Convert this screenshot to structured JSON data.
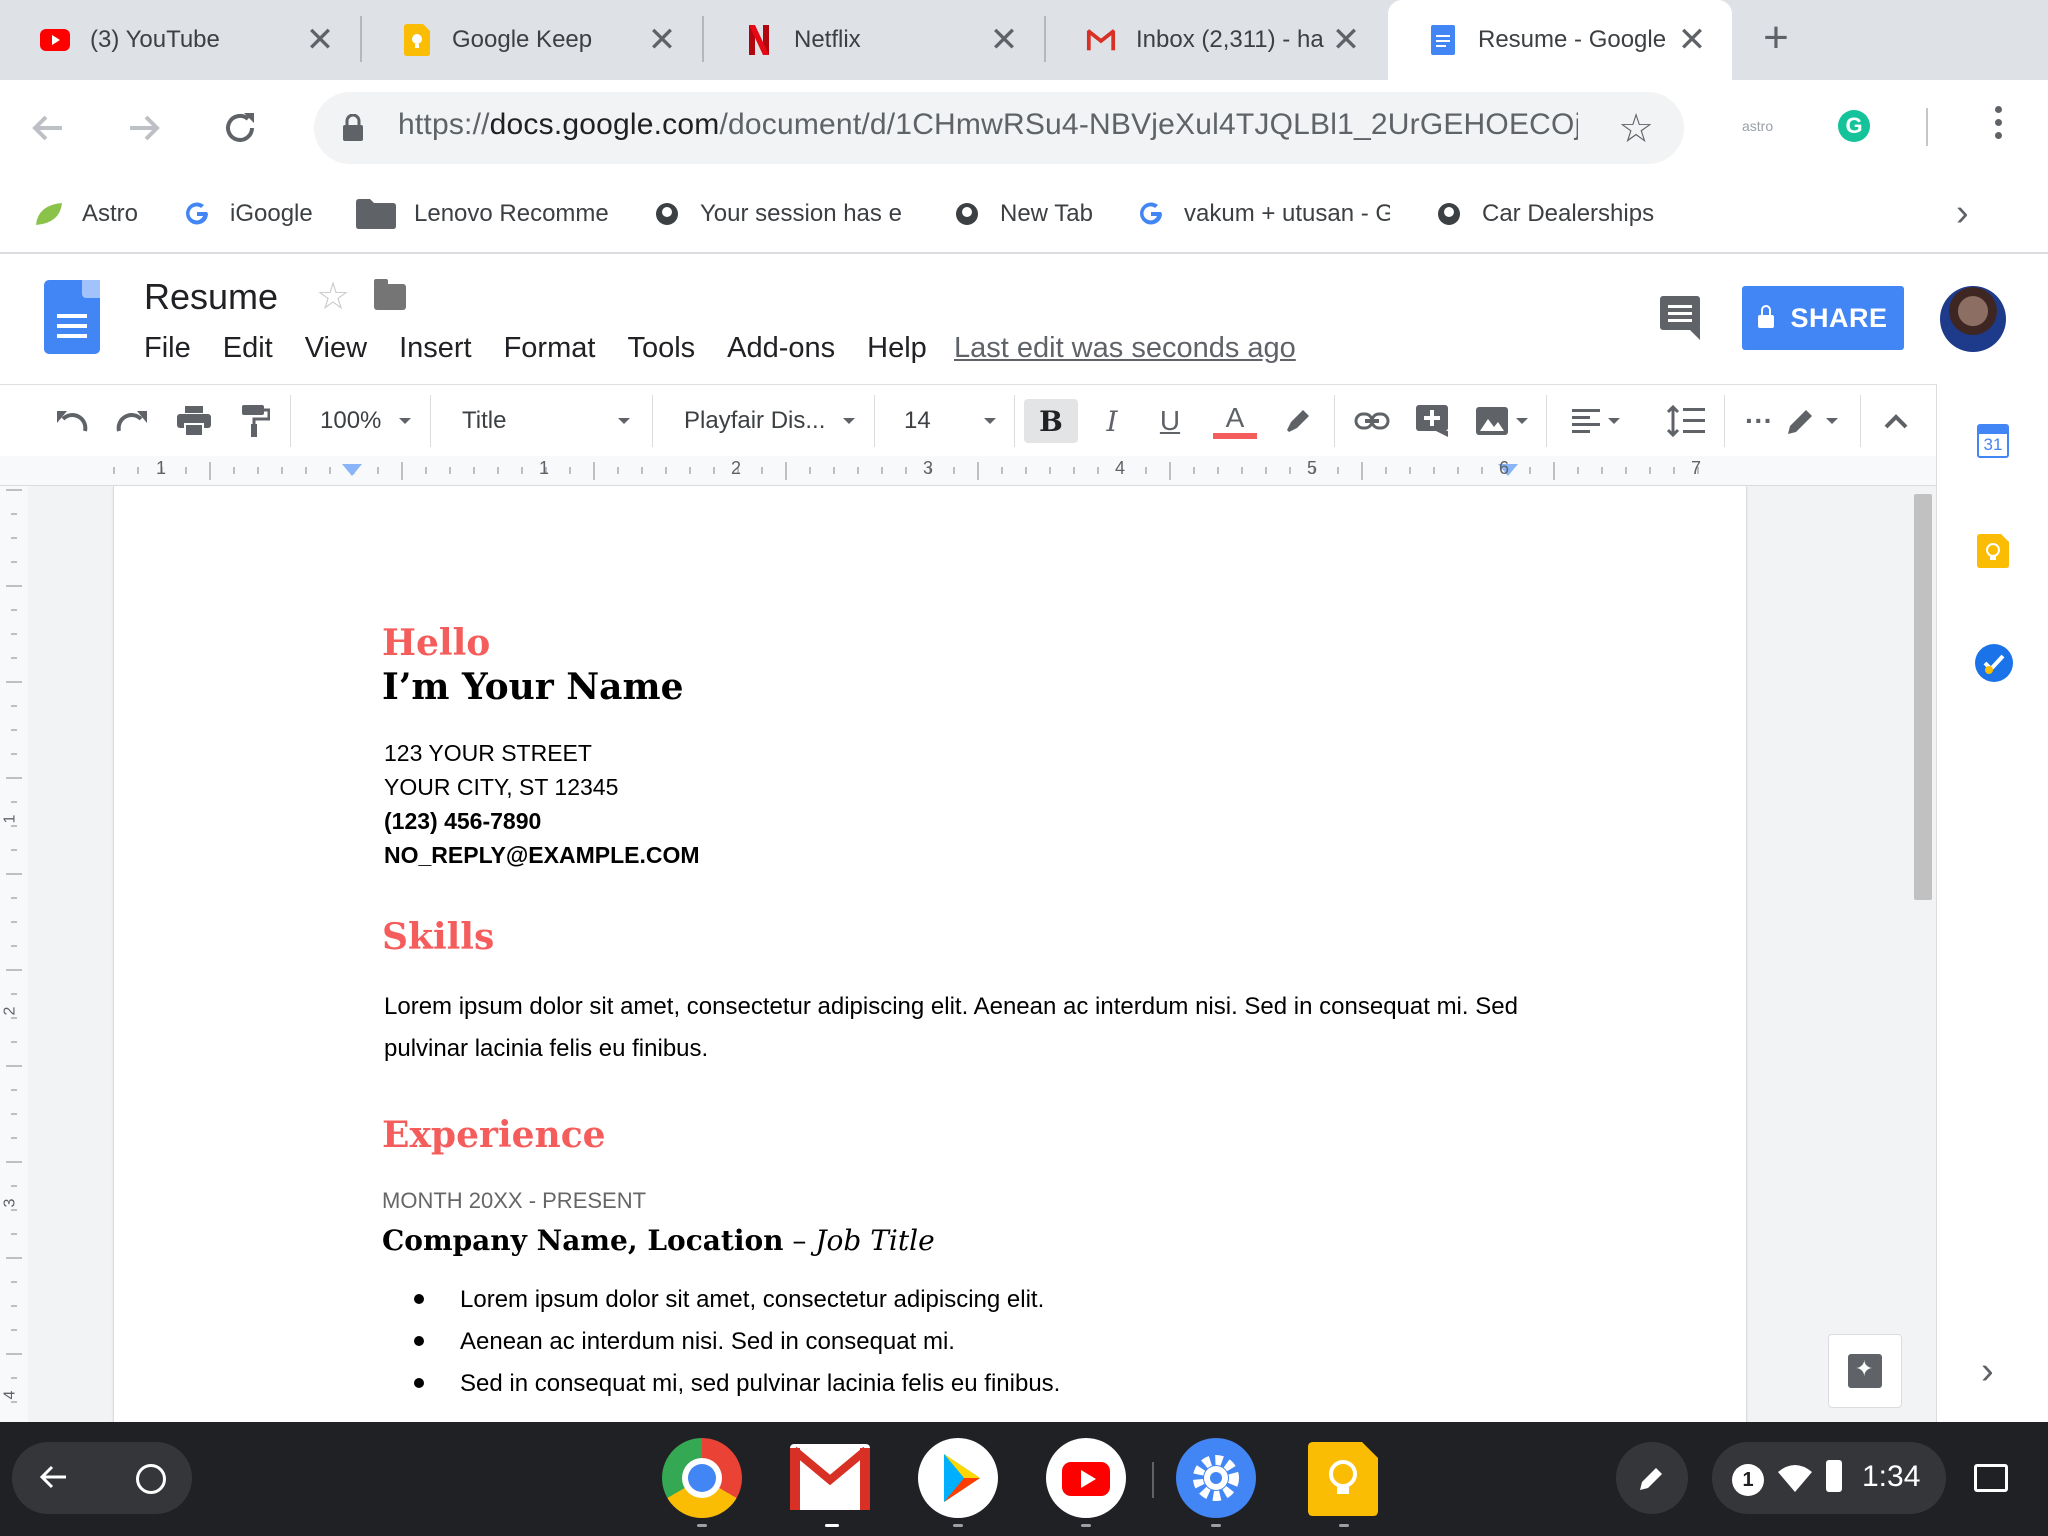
{
  "browser": {
    "tabs": [
      {
        "title": "(3) YouTube",
        "icon": "youtube-icon"
      },
      {
        "title": "Google Keep",
        "icon": "keep-icon"
      },
      {
        "title": "Netflix",
        "icon": "netflix-icon"
      },
      {
        "title": "Inbox (2,311) - ha",
        "icon": "gmail-icon"
      },
      {
        "title": "Resume - Google D",
        "icon": "docs-icon",
        "active": true
      }
    ],
    "url_prefix": "https://",
    "url_host": "docs.google.com",
    "url_path": "/document/d/1CHmwRSu4-NBVjeXul4TJQLBl1_2UrGEHOECOj...",
    "extension_label": "astro",
    "grammarly_letter": "G",
    "bookmarks": [
      {
        "label": "Astro",
        "icon": "astro-leaf-icon"
      },
      {
        "label": "iGoogle",
        "icon": "google-g-icon"
      },
      {
        "label": "Lenovo Recomme",
        "icon": "folder-icon"
      },
      {
        "label": "Your session has e",
        "icon": "site-icon"
      },
      {
        "label": "New Tab",
        "icon": "site-icon"
      },
      {
        "label": "vakum + utusan - G",
        "icon": "google-g-icon"
      },
      {
        "label": "Car Dealerships",
        "icon": "site-icon"
      }
    ]
  },
  "docs": {
    "title": "Resume",
    "menu": [
      "File",
      "Edit",
      "View",
      "Insert",
      "Format",
      "Tools",
      "Add-ons",
      "Help"
    ],
    "last_edit": "Last edit was seconds ago",
    "share_label": "SHARE",
    "toolbar": {
      "zoom": "100%",
      "style": "Title",
      "font": "Playfair Dis...",
      "size": "14",
      "bold": "B",
      "italic": "I",
      "underline": "U",
      "text_color_letter": "A"
    },
    "ruler_numbers": [
      "1",
      "1",
      "2",
      "3",
      "4",
      "5",
      "6",
      "7"
    ],
    "vruler_numbers": [
      "1",
      "2",
      "3",
      "4"
    ],
    "calendar_day": "31"
  },
  "document": {
    "greeting": "Hello",
    "name": "I’m Your Name",
    "address1": "123 YOUR STREET",
    "address2": "YOUR CITY, ST 12345",
    "phone": "(123) 456-7890",
    "email": "NO_REPLY@EXAMPLE.COM",
    "skills_heading": "Skills",
    "skills_text": "Lorem ipsum dolor sit amet, consectetur adipiscing elit. Aenean ac interdum nisi. Sed in consequat mi. Sed pulvinar lacinia felis eu finibus.",
    "experience_heading": "Experience",
    "exp_date": "MONTH 20XX - PRESENT",
    "exp_company": "Company Name, Location",
    "exp_dash": " – ",
    "exp_title": "Job Title",
    "bullets": [
      "Lorem ipsum dolor sit amet, consectetur adipiscing elit.",
      "Aenean ac interdum nisi. Sed in consequat mi.",
      "Sed in consequat mi, sed pulvinar lacinia felis eu finibus."
    ]
  },
  "shelf": {
    "apps": [
      "chrome-icon",
      "gmail-icon",
      "play-store-icon",
      "youtube-icon",
      "settings-icon",
      "keep-icon"
    ],
    "notification_count": "1",
    "time": "1:34"
  },
  "colors": {
    "accent": "#f55d5d",
    "docs_blue": "#4285f4",
    "shelf": "#202124"
  }
}
